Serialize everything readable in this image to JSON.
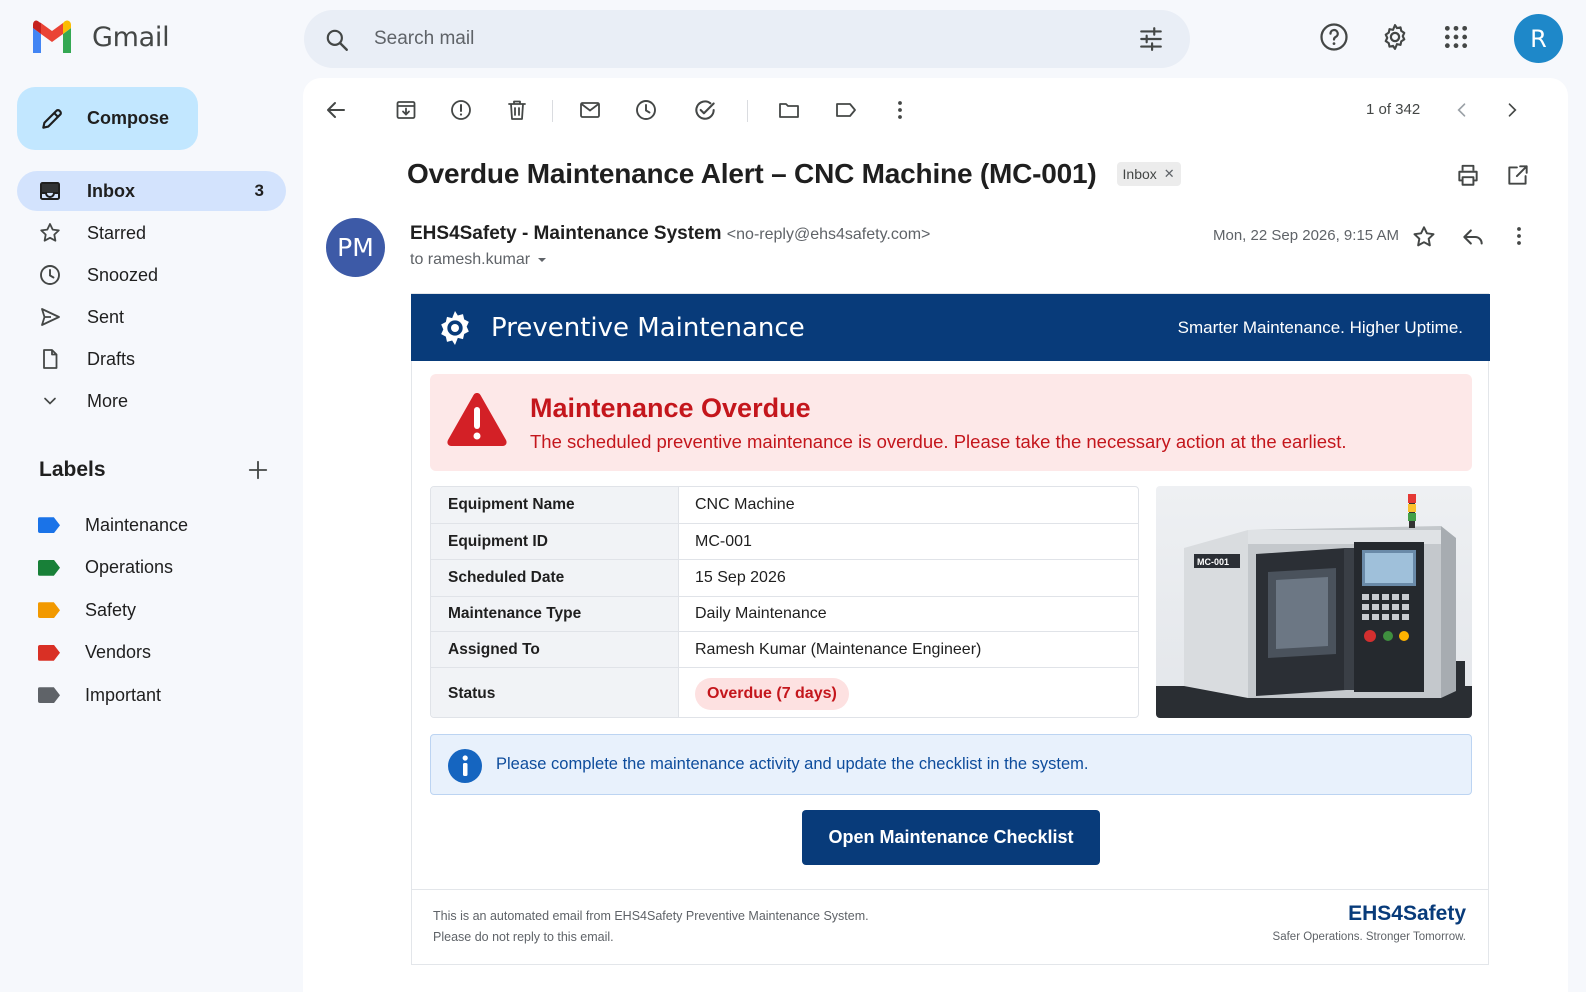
{
  "app": {
    "name": "Gmail",
    "avatar_letter": "R"
  },
  "search": {
    "placeholder": "Search mail"
  },
  "sidebar": {
    "compose_label": "Compose",
    "items": [
      {
        "label": "Inbox",
        "count": "3",
        "icon": "inbox-icon"
      },
      {
        "label": "Starred",
        "icon": "star-icon"
      },
      {
        "label": "Snoozed",
        "icon": "clock-icon"
      },
      {
        "label": "Sent",
        "icon": "send-icon"
      },
      {
        "label": "Drafts",
        "icon": "draft-icon"
      },
      {
        "label": "More",
        "icon": "chevron-down-icon"
      }
    ],
    "labels_title": "Labels",
    "labels": [
      {
        "name": "Maintenance",
        "color": "#1a73e8"
      },
      {
        "name": "Operations",
        "color": "#188038"
      },
      {
        "name": "Safety",
        "color": "#f29900"
      },
      {
        "name": "Vendors",
        "color": "#d93025"
      },
      {
        "name": "Important",
        "color": "#5f6368"
      }
    ]
  },
  "toolbar": {
    "pager": "1 of 342"
  },
  "message": {
    "subject": "Overdue Maintenance Alert – CNC Machine (MC-001)",
    "chip": "Inbox",
    "sender_initials": "PM",
    "sender_name": "EHS4Safety - Maintenance System",
    "sender_email": "<no-reply@ehs4safety.com>",
    "to": "to ramesh.kumar",
    "date": "Mon, 22 Sep 2026, 9:15 AM"
  },
  "email": {
    "header_title": "Preventive Maintenance",
    "header_tagline": "Smarter Maintenance. Higher Uptime.",
    "alert_title": "Maintenance Overdue",
    "alert_message": "The scheduled preventive maintenance is overdue. Please take the necessary action at the earliest.",
    "details": [
      {
        "key": "Equipment Name",
        "value": "CNC Machine"
      },
      {
        "key": "Equipment ID",
        "value": "MC-001"
      },
      {
        "key": "Scheduled Date",
        "value": "15 Sep 2026"
      },
      {
        "key": "Maintenance Type",
        "value": "Daily Maintenance"
      },
      {
        "key": "Assigned To",
        "value": "Ramesh Kumar (Maintenance Engineer)"
      },
      {
        "key": "Status",
        "value": "Overdue (7 days)"
      }
    ],
    "machine_tag": "MC-001",
    "info_message": "Please complete the maintenance activity and update the checklist in the system.",
    "cta_label": "Open Maintenance Checklist",
    "footer_line1": "This is an automated email from EHS4Safety Preventive Maintenance System.",
    "footer_line2": "Please do not reply to this email.",
    "footer_brand": "EHS4Safety",
    "footer_tagline": "Safer Operations. Stronger Tomorrow.",
    "accent_color": "#083b7a",
    "alert_color": "#c4161c"
  }
}
